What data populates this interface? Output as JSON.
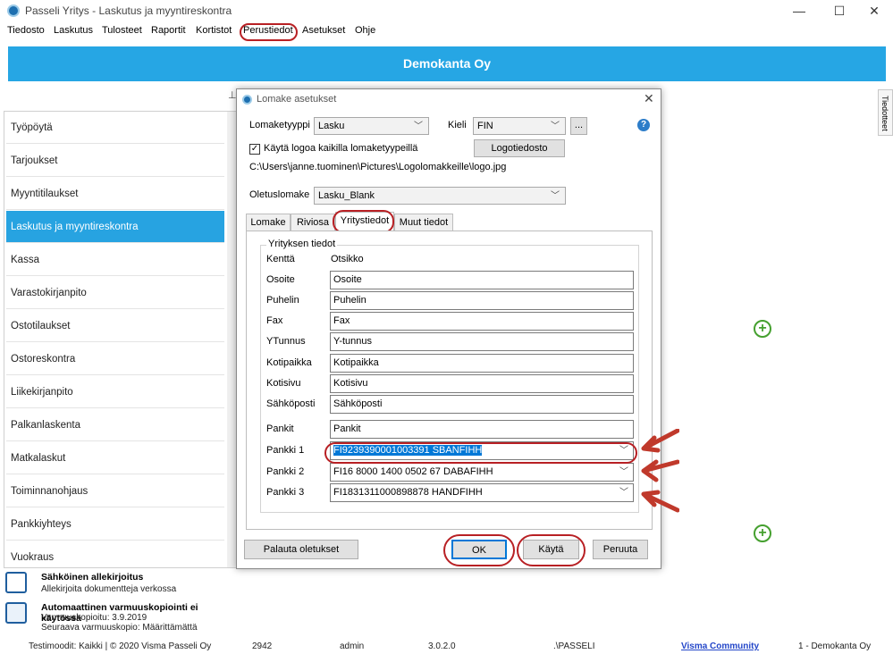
{
  "window": {
    "title": "Passeli Yritys - Laskutus ja myyntireskontra",
    "minimize": "—",
    "maximize": "☐",
    "close": "✕"
  },
  "menu": [
    "Tiedosto",
    "Laskutus",
    "Tulosteet",
    "Raportit",
    "Kortistot",
    "Perustiedot",
    "Asetukset",
    "Ohje"
  ],
  "banner": "Demokanta Oy",
  "sidebar": {
    "items": [
      "Työpöytä",
      "Tarjoukset",
      "Myyntitilaukset",
      "Laskutus ja myyntireskontra",
      "Kassa",
      "Varastokirjanpito",
      "Ostotilaukset",
      "Ostoreskontra",
      "Liikekirjanpito",
      "Palkanlaskenta",
      "Matkalaskut",
      "Toiminnanohjaus",
      "Pankkiyhteys",
      "Vuokraus"
    ],
    "active_index": 3
  },
  "info": {
    "sign_title": "Sähköinen allekirjoitus",
    "sign_sub": "Allekirjoita dokumentteja verkossa",
    "backup_title": "Automaattinen varmuuskopiointi ei käytössä",
    "backup_sub1": "Varmuuskopioitu: 3.9.2019",
    "backup_sub2": "Seuraava varmuuskopio: Määrittämättä"
  },
  "statusbar": {
    "mode": "Testimoodit: Kaikki | © 2020 Visma Passeli Oy",
    "num": "2942",
    "user": "admin",
    "version": "3.0.2.0",
    "path": ".\\PASSELI",
    "community": "Visma Community",
    "company": "1 - Demokanta Oy"
  },
  "right_tab": "Tiedotteet",
  "dialog": {
    "title": "Lomake asetukset",
    "form_type_label": "Lomaketyyppi",
    "form_type_value": "Lasku",
    "lang_label": "Kieli",
    "lang_value": "FIN",
    "dots_button": "...",
    "use_logo_label": "Käytä logoa kaikilla lomaketyypeillä",
    "logo_button": "Logotiedosto",
    "logo_path": "C:\\Users\\janne.tuominen\\Pictures\\Logolomakkeille\\logo.jpg",
    "default_form_label": "Oletuslomake",
    "default_form_value": "Lasku_Blank",
    "tabs": [
      "Lomake",
      "Riviosa",
      "Yritystiedot",
      "Muut tiedot"
    ],
    "group_title": "Yrityksen tiedot",
    "col_field": "Kenttä",
    "col_title": "Otsikko",
    "rows": [
      {
        "label": "Osoite",
        "value": "Osoite"
      },
      {
        "label": "Puhelin",
        "value": "Puhelin"
      },
      {
        "label": "Fax",
        "value": "Fax"
      },
      {
        "label": "YTunnus",
        "value": "Y-tunnus"
      },
      {
        "label": "Kotipaikka",
        "value": "Kotipaikka"
      },
      {
        "label": "Kotisivu",
        "value": "Kotisivu"
      },
      {
        "label": "Sähköposti",
        "value": "Sähköposti"
      },
      {
        "label": "Pankit",
        "value": "Pankit"
      }
    ],
    "banks": [
      {
        "label": "Pankki 1",
        "value": "FI9239390001003391 SBANFIHH"
      },
      {
        "label": "Pankki 2",
        "value": "FI16 8000 1400 0502 67 DABAFIHH"
      },
      {
        "label": "Pankki 3",
        "value": "FI1831311000898878 HANDFIHH"
      }
    ],
    "reset_button": "Palauta oletukset",
    "ok_button": "OK",
    "apply_button": "Käytä",
    "cancel_button": "Peruuta"
  },
  "colors": {
    "accent": "#26a6e4",
    "highlight_circle": "#b82024",
    "arrow": "#c0392b",
    "plus": "#45a02f"
  }
}
